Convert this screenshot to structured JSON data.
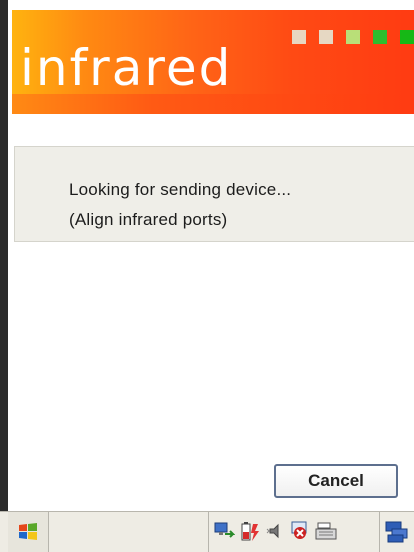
{
  "banner": {
    "title": "infrared"
  },
  "status": {
    "line1": "Looking for sending device...",
    "line2": "(Align infrared ports)"
  },
  "buttons": {
    "cancel_label": "Cancel"
  },
  "colors": {
    "banner_start": "#ffb30f",
    "banner_end": "#ff3b12",
    "panel_bg": "#efeee8",
    "taskbar_bg": "#eeece4"
  },
  "taskbar": {
    "icons": [
      "windows-logo-icon",
      "network-icon",
      "battery-icon",
      "volume-icon",
      "connection-status-icon",
      "keyboard-icon",
      "desktop-switch-icon"
    ]
  }
}
